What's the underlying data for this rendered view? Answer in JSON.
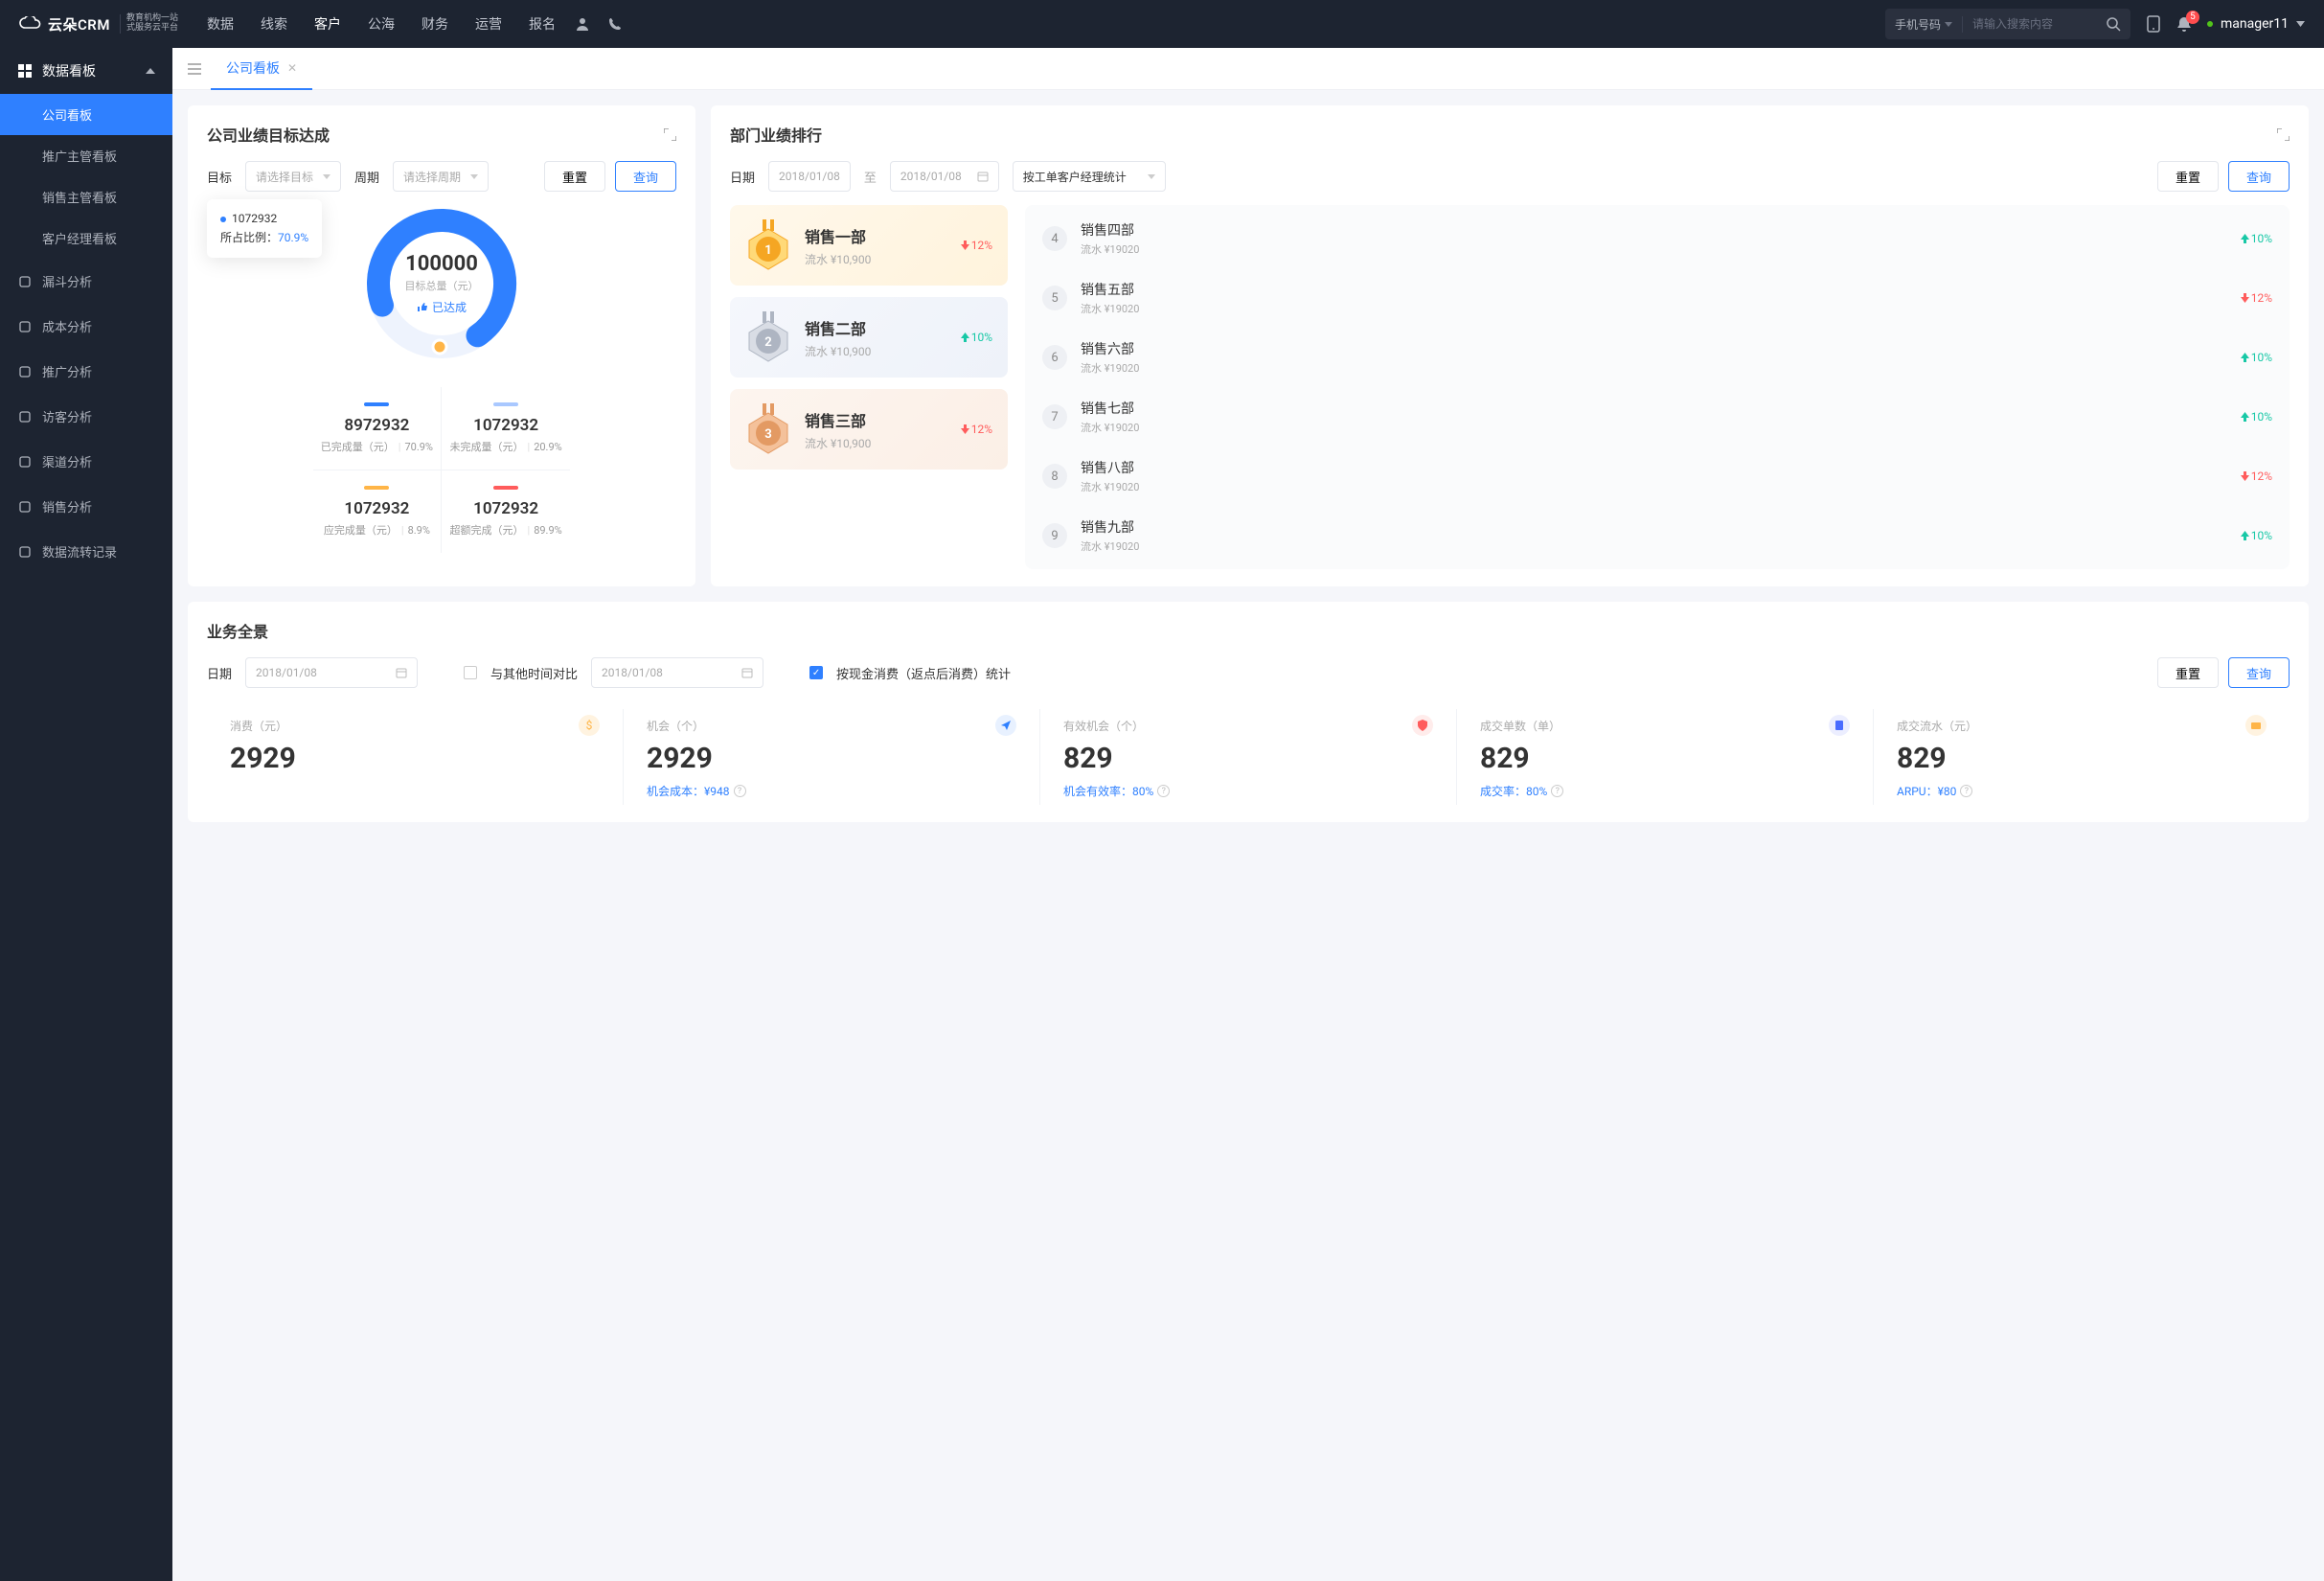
{
  "header": {
    "logo_text": "云朵CRM",
    "logo_sub1": "教育机构一站",
    "logo_sub2": "式服务云平台",
    "nav": [
      "数据",
      "线索",
      "客户",
      "公海",
      "财务",
      "运营",
      "报名"
    ],
    "nav_active": 2,
    "search_type": "手机号码",
    "search_placeholder": "请输入搜索内容",
    "notif_count": "5",
    "username": "manager11"
  },
  "sidebar": {
    "group_title": "数据看板",
    "subs": [
      "公司看板",
      "推广主管看板",
      "销售主管看板",
      "客户经理看板"
    ],
    "sub_active": 0,
    "items": [
      "漏斗分析",
      "成本分析",
      "推广分析",
      "访客分析",
      "渠道分析",
      "销售分析",
      "数据流转记录"
    ]
  },
  "tabs": {
    "active_label": "公司看板"
  },
  "target": {
    "title": "公司业绩目标达成",
    "lbl_target": "目标",
    "sel_target": "请选择目标",
    "lbl_period": "周期",
    "sel_period": "请选择周期",
    "btn_reset": "重置",
    "btn_query": "查询",
    "tooltip_val": "1072932",
    "tooltip_lbl": "所占比例：",
    "tooltip_pct": "70.9%",
    "center_val": "100000",
    "center_lbl": "目标总量（元）",
    "reached": "已达成",
    "cells": [
      {
        "val": "8972932",
        "lbl": "已完成量（元）",
        "pct": "70.9%"
      },
      {
        "val": "1072932",
        "lbl": "未完成量（元）",
        "pct": "20.9%"
      },
      {
        "val": "1072932",
        "lbl": "应完成量（元）",
        "pct": "8.9%"
      },
      {
        "val": "1072932",
        "lbl": "超额完成（元）",
        "pct": "89.9%"
      }
    ]
  },
  "ranking": {
    "title": "部门业绩排行",
    "lbl_date": "日期",
    "date_from": "2018/01/08",
    "date_sep": "至",
    "date_to": "2018/01/08",
    "sel_stat": "按工单客户经理统计",
    "btn_reset": "重置",
    "btn_query": "查询",
    "top3": [
      {
        "name": "销售一部",
        "sub": "流水 ¥10,900",
        "trend": "12%",
        "dir": "down"
      },
      {
        "name": "销售二部",
        "sub": "流水 ¥10,900",
        "trend": "10%",
        "dir": "up"
      },
      {
        "name": "销售三部",
        "sub": "流水 ¥10,900",
        "trend": "12%",
        "dir": "down"
      }
    ],
    "rest": [
      {
        "n": "4",
        "name": "销售四部",
        "sub": "流水 ¥19020",
        "trend": "10%",
        "dir": "up"
      },
      {
        "n": "5",
        "name": "销售五部",
        "sub": "流水 ¥19020",
        "trend": "12%",
        "dir": "down"
      },
      {
        "n": "6",
        "name": "销售六部",
        "sub": "流水 ¥19020",
        "trend": "10%",
        "dir": "up"
      },
      {
        "n": "7",
        "name": "销售七部",
        "sub": "流水 ¥19020",
        "trend": "10%",
        "dir": "up"
      },
      {
        "n": "8",
        "name": "销售八部",
        "sub": "流水 ¥19020",
        "trend": "12%",
        "dir": "down"
      },
      {
        "n": "9",
        "name": "销售九部",
        "sub": "流水 ¥19020",
        "trend": "10%",
        "dir": "up"
      }
    ]
  },
  "biz": {
    "title": "业务全景",
    "lbl_date": "日期",
    "date1": "2018/01/08",
    "compare_lbl": "与其他时间对比",
    "date2": "2018/01/08",
    "cash_lbl": "按现金消费（返点后消费）统计",
    "btn_reset": "重置",
    "btn_query": "查询",
    "stats": [
      {
        "label": "消费（元）",
        "val": "2929",
        "foot": "",
        "icon": "money",
        "color": "#ffb547"
      },
      {
        "label": "机会（个）",
        "val": "2929",
        "foot": "机会成本：¥948",
        "icon": "send",
        "color": "#2f80ff"
      },
      {
        "label": "有效机会（个）",
        "val": "829",
        "foot": "机会有效率：80%",
        "icon": "shield",
        "color": "#ff5c5c"
      },
      {
        "label": "成交单数（单）",
        "val": "829",
        "foot": "成交率：80%",
        "icon": "doc",
        "color": "#4a6cff"
      },
      {
        "label": "成交流水（元）",
        "val": "829",
        "foot": "ARPU：¥80",
        "icon": "card",
        "color": "#ffb547"
      }
    ]
  },
  "chart_data": {
    "type": "pie",
    "title": "目标达成",
    "series": [
      {
        "name": "已完成量",
        "value": 8972932,
        "pct": 70.9
      },
      {
        "name": "未完成量",
        "value": 1072932,
        "pct": 20.9
      },
      {
        "name": "应完成量",
        "value": 1072932,
        "pct": 8.9
      }
    ],
    "target_total": 100000
  }
}
